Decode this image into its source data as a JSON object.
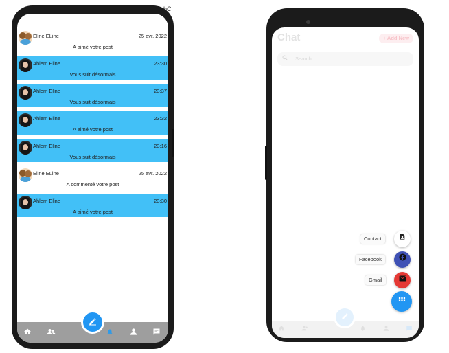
{
  "notifications": [
    {
      "name": "Eline ELine",
      "time": "25 avr. 2022",
      "text": "A aimé votre post",
      "unread": false,
      "avatar": "group-avatar-icon"
    },
    {
      "name": "Ahlem Eline",
      "time": "23:30",
      "text": "Vous suit désormais",
      "unread": true,
      "avatar": "woman-avatar-icon"
    },
    {
      "name": "Ahlem Eline",
      "time": "23:37",
      "text": "Vous suit désormais",
      "unread": true,
      "avatar": "woman-avatar-icon"
    },
    {
      "name": "Ahlem Eline",
      "time": "23:32",
      "text": "A aimé votre post",
      "unread": true,
      "avatar": "woman-avatar-icon"
    },
    {
      "name": "Ahlem Eline",
      "time": "23:16",
      "text": "Vous suit désormais",
      "unread": true,
      "avatar": "woman-avatar-icon"
    },
    {
      "name": "Eline ELine",
      "time": "25 avr. 2022",
      "text": "A commenté votre post",
      "unread": false,
      "avatar": "group-avatar-icon"
    },
    {
      "name": "Ahlem Eline",
      "time": "23:30",
      "text": "A aimé votre post",
      "unread": true,
      "avatar": "woman-avatar-icon"
    }
  ],
  "chat": {
    "title": "Chat",
    "add_new": "Add New",
    "search_placeholder": "Search..."
  },
  "share_options": {
    "contact": "Contact",
    "facebook": "Facebook",
    "gmail": "Gmail"
  },
  "background_fragments": {
    "top_right": "bC"
  },
  "colors": {
    "unread_row": "#42c0f7",
    "primary_blue": "#2196f3",
    "nav_gray": "#9e9e9e",
    "facebook": "#3b5998",
    "gmail": "#e53935"
  },
  "icons": {
    "nav": [
      "home-icon",
      "people-icon",
      "bell-icon",
      "person-icon",
      "chat-icon"
    ],
    "fab": "edit-icon",
    "share": [
      "contact-icon",
      "facebook-icon",
      "mail-icon",
      "grid-icon"
    ]
  }
}
